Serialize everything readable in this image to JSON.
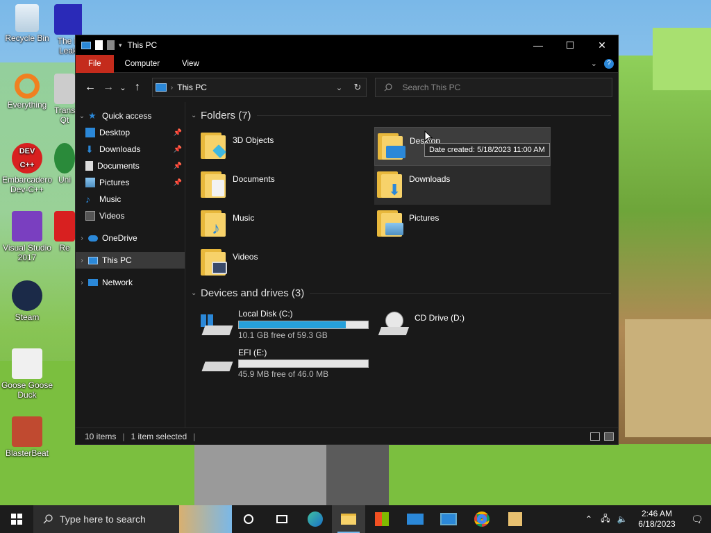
{
  "desktop": {
    "icons": [
      {
        "label": "Recycle Bin"
      },
      {
        "label": "The L\nLeak"
      },
      {
        "label": "Everything"
      },
      {
        "label": "Trans\nQt"
      },
      {
        "label": "Embarcadero\nDev-C++"
      },
      {
        "label": "Uni"
      },
      {
        "label": "Visual Studio\n2017"
      },
      {
        "label": "Re"
      },
      {
        "label": "Steam"
      },
      {
        "label": "Goose Goose\nDuck"
      },
      {
        "label": "BlasterBeat"
      }
    ]
  },
  "window": {
    "title": "This PC",
    "controls": {
      "minimize": "—",
      "maximize": "☐",
      "close": "✕"
    },
    "ribbon_tabs": [
      "File",
      "Computer",
      "View"
    ],
    "address": {
      "location": "This PC",
      "separator": "›"
    },
    "search": {
      "placeholder": "Search This PC"
    },
    "nav": {
      "back": "←",
      "forward": "→",
      "recent": "⌄",
      "up": "↑"
    },
    "sidebar": {
      "quick_access": "Quick access",
      "quick_items": [
        {
          "label": "Desktop",
          "pinned": true
        },
        {
          "label": "Downloads",
          "pinned": true
        },
        {
          "label": "Documents",
          "pinned": true
        },
        {
          "label": "Pictures",
          "pinned": true
        },
        {
          "label": "Music",
          "pinned": false
        },
        {
          "label": "Videos",
          "pinned": false
        }
      ],
      "onedrive": "OneDrive",
      "this_pc": "This PC",
      "network": "Network"
    },
    "groups": {
      "folders": "Folders (7)",
      "drives": "Devices and drives (3)"
    },
    "folders": [
      {
        "label": "3D Objects"
      },
      {
        "label": "Desktop"
      },
      {
        "label": "Documents"
      },
      {
        "label": "Downloads"
      },
      {
        "label": "Music"
      },
      {
        "label": "Pictures"
      },
      {
        "label": "Videos"
      }
    ],
    "tooltip": "Date created: 5/18/2023 11:00 AM",
    "drives": [
      {
        "label": "Local Disk (C:)",
        "free": "10.1 GB free of 59.3 GB",
        "used_fraction": 0.83
      },
      {
        "label": "CD Drive (D:)"
      },
      {
        "label": "EFI (E:)",
        "free": "45.9 MB free of 46.0 MB",
        "used_fraction": 0.0
      }
    ],
    "status": {
      "items": "10 items",
      "selected": "1 item selected"
    }
  },
  "taskbar": {
    "search_placeholder": "Type here to search",
    "time": "2:46 AM",
    "date": "6/18/2023"
  },
  "colors": {
    "accent": "#c42b1c",
    "progress": "#26a0da",
    "folder": "#f7d26a"
  }
}
